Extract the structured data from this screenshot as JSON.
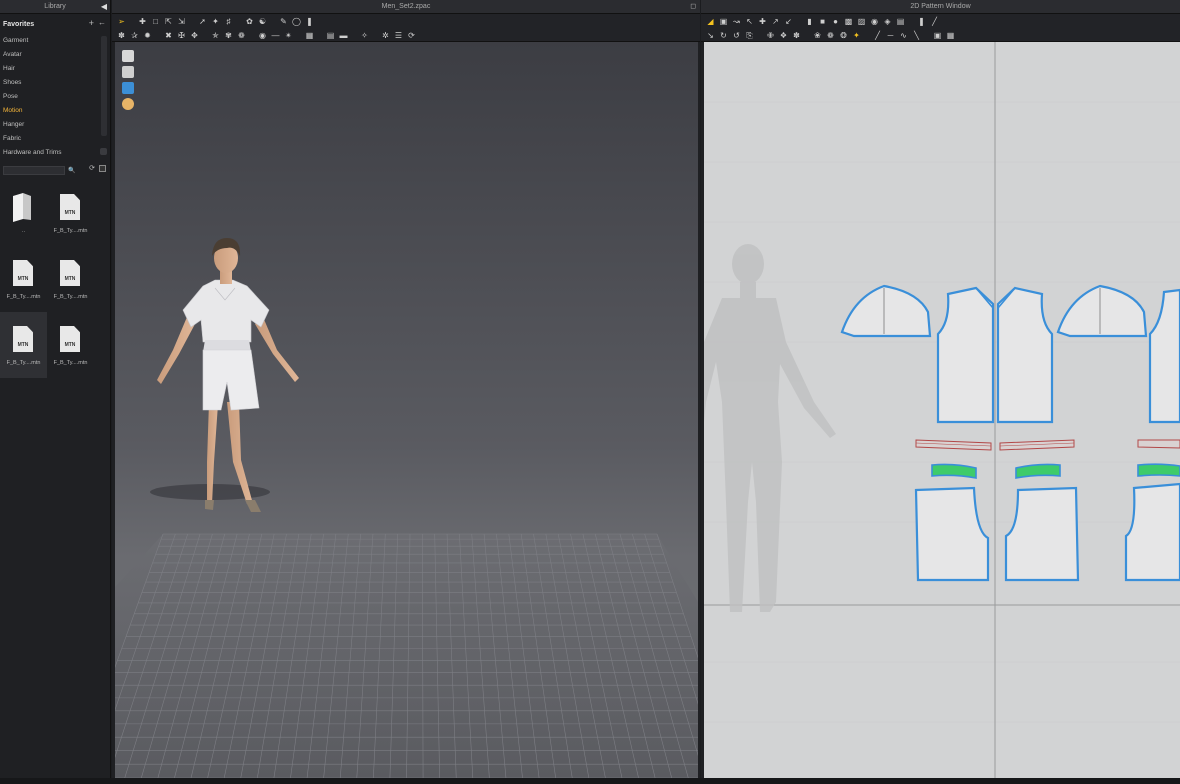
{
  "library": {
    "title": "Library",
    "collapse_icon": "triangle-left-icon",
    "favorites_label": "Favorites",
    "categories": [
      {
        "label": "Garment"
      },
      {
        "label": "Avatar"
      },
      {
        "label": "Hair"
      },
      {
        "label": "Shoes"
      },
      {
        "label": "Pose"
      },
      {
        "label": "Motion",
        "active": true
      },
      {
        "label": "Hanger"
      },
      {
        "label": "Fabric"
      },
      {
        "label": "Hardware and Trims"
      }
    ],
    "search": {
      "value": "",
      "placeholder": ""
    },
    "files": [
      {
        "name": "..",
        "kind": "folder"
      },
      {
        "name": "F_B_Ty....mtn",
        "kind": "mtn",
        "icon_text": "MTN"
      },
      {
        "name": "F_B_Ty....mtn",
        "kind": "mtn",
        "icon_text": "MTN"
      },
      {
        "name": "F_B_Ty....mtn",
        "kind": "mtn",
        "icon_text": "MTN"
      },
      {
        "name": "F_B_Ty....mtn",
        "kind": "mtn",
        "icon_text": "MTN",
        "selected": true
      },
      {
        "name": "F_B_Ty....mtn",
        "kind": "mtn",
        "icon_text": "MTN"
      }
    ]
  },
  "window3d": {
    "title": "Men_Set2.zpac",
    "side_icons": [
      "garment-display-icon",
      "avatar-display-icon",
      "fabric-render-icon",
      "avatar-skin-icon"
    ]
  },
  "window2d": {
    "title": "2D Pattern Window"
  },
  "colors": {
    "accent": "#f4b53a",
    "pattern_outline": "#3a8fd9",
    "pattern_fill": "#e6e6e7",
    "rib_fill": "#3ecb6a",
    "seam_red": "#b24848"
  }
}
